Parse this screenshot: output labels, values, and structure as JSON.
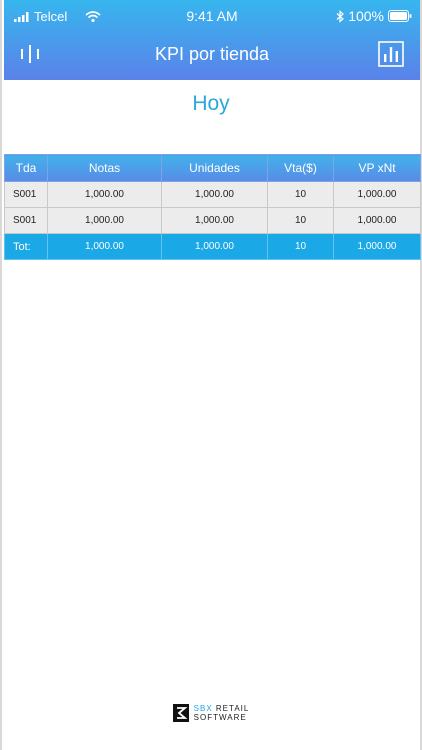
{
  "status_bar": {
    "carrier": "Telcel",
    "time": "9:41 AM",
    "battery": "100%"
  },
  "nav": {
    "title": "KPI por tienda",
    "left_icon": "menu-bars-icon",
    "right_icon": "bar-chart-icon"
  },
  "period": {
    "title": "Hoy"
  },
  "table": {
    "headers": [
      "Tda",
      "Notas",
      "Unidades",
      "Vta($)",
      "VP xNt"
    ],
    "rows": [
      [
        "S001",
        "1,000.00",
        "1,000.00",
        "10",
        "1,000.00"
      ],
      [
        "S001",
        "1,000.00",
        "1,000.00",
        "10",
        "1,000.00"
      ]
    ],
    "total": [
      "Tot:",
      "1,000.00",
      "1,000.00",
      "10",
      "1,000.00"
    ]
  },
  "footer_logo": {
    "brand": "SBX",
    "line1": "RETAIL",
    "line2": "SOFTWARE"
  },
  "colors": {
    "header_top": "#37b6ee",
    "header_bottom": "#5a82e9",
    "accent": "#1ba8e6",
    "row_bg": "#ececec"
  }
}
